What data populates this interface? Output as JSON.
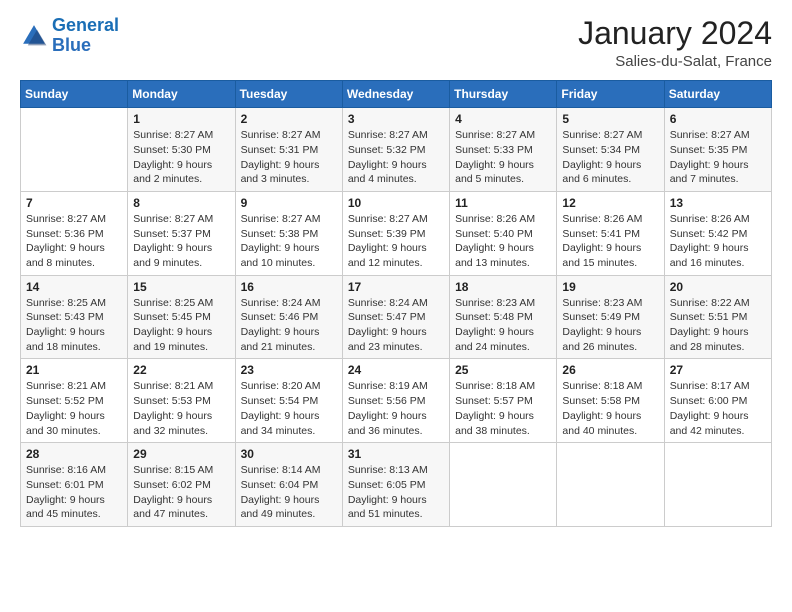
{
  "logo": {
    "line1": "General",
    "line2": "Blue"
  },
  "header": {
    "month_year": "January 2024",
    "location": "Salies-du-Salat, France"
  },
  "weekdays": [
    "Sunday",
    "Monday",
    "Tuesday",
    "Wednesday",
    "Thursday",
    "Friday",
    "Saturday"
  ],
  "weeks": [
    [
      {
        "day": "",
        "info": ""
      },
      {
        "day": "1",
        "info": "Sunrise: 8:27 AM\nSunset: 5:30 PM\nDaylight: 9 hours\nand 2 minutes."
      },
      {
        "day": "2",
        "info": "Sunrise: 8:27 AM\nSunset: 5:31 PM\nDaylight: 9 hours\nand 3 minutes."
      },
      {
        "day": "3",
        "info": "Sunrise: 8:27 AM\nSunset: 5:32 PM\nDaylight: 9 hours\nand 4 minutes."
      },
      {
        "day": "4",
        "info": "Sunrise: 8:27 AM\nSunset: 5:33 PM\nDaylight: 9 hours\nand 5 minutes."
      },
      {
        "day": "5",
        "info": "Sunrise: 8:27 AM\nSunset: 5:34 PM\nDaylight: 9 hours\nand 6 minutes."
      },
      {
        "day": "6",
        "info": "Sunrise: 8:27 AM\nSunset: 5:35 PM\nDaylight: 9 hours\nand 7 minutes."
      }
    ],
    [
      {
        "day": "7",
        "info": "Sunrise: 8:27 AM\nSunset: 5:36 PM\nDaylight: 9 hours\nand 8 minutes."
      },
      {
        "day": "8",
        "info": "Sunrise: 8:27 AM\nSunset: 5:37 PM\nDaylight: 9 hours\nand 9 minutes."
      },
      {
        "day": "9",
        "info": "Sunrise: 8:27 AM\nSunset: 5:38 PM\nDaylight: 9 hours\nand 10 minutes."
      },
      {
        "day": "10",
        "info": "Sunrise: 8:27 AM\nSunset: 5:39 PM\nDaylight: 9 hours\nand 12 minutes."
      },
      {
        "day": "11",
        "info": "Sunrise: 8:26 AM\nSunset: 5:40 PM\nDaylight: 9 hours\nand 13 minutes."
      },
      {
        "day": "12",
        "info": "Sunrise: 8:26 AM\nSunset: 5:41 PM\nDaylight: 9 hours\nand 15 minutes."
      },
      {
        "day": "13",
        "info": "Sunrise: 8:26 AM\nSunset: 5:42 PM\nDaylight: 9 hours\nand 16 minutes."
      }
    ],
    [
      {
        "day": "14",
        "info": "Sunrise: 8:25 AM\nSunset: 5:43 PM\nDaylight: 9 hours\nand 18 minutes."
      },
      {
        "day": "15",
        "info": "Sunrise: 8:25 AM\nSunset: 5:45 PM\nDaylight: 9 hours\nand 19 minutes."
      },
      {
        "day": "16",
        "info": "Sunrise: 8:24 AM\nSunset: 5:46 PM\nDaylight: 9 hours\nand 21 minutes."
      },
      {
        "day": "17",
        "info": "Sunrise: 8:24 AM\nSunset: 5:47 PM\nDaylight: 9 hours\nand 23 minutes."
      },
      {
        "day": "18",
        "info": "Sunrise: 8:23 AM\nSunset: 5:48 PM\nDaylight: 9 hours\nand 24 minutes."
      },
      {
        "day": "19",
        "info": "Sunrise: 8:23 AM\nSunset: 5:49 PM\nDaylight: 9 hours\nand 26 minutes."
      },
      {
        "day": "20",
        "info": "Sunrise: 8:22 AM\nSunset: 5:51 PM\nDaylight: 9 hours\nand 28 minutes."
      }
    ],
    [
      {
        "day": "21",
        "info": "Sunrise: 8:21 AM\nSunset: 5:52 PM\nDaylight: 9 hours\nand 30 minutes."
      },
      {
        "day": "22",
        "info": "Sunrise: 8:21 AM\nSunset: 5:53 PM\nDaylight: 9 hours\nand 32 minutes."
      },
      {
        "day": "23",
        "info": "Sunrise: 8:20 AM\nSunset: 5:54 PM\nDaylight: 9 hours\nand 34 minutes."
      },
      {
        "day": "24",
        "info": "Sunrise: 8:19 AM\nSunset: 5:56 PM\nDaylight: 9 hours\nand 36 minutes."
      },
      {
        "day": "25",
        "info": "Sunrise: 8:18 AM\nSunset: 5:57 PM\nDaylight: 9 hours\nand 38 minutes."
      },
      {
        "day": "26",
        "info": "Sunrise: 8:18 AM\nSunset: 5:58 PM\nDaylight: 9 hours\nand 40 minutes."
      },
      {
        "day": "27",
        "info": "Sunrise: 8:17 AM\nSunset: 6:00 PM\nDaylight: 9 hours\nand 42 minutes."
      }
    ],
    [
      {
        "day": "28",
        "info": "Sunrise: 8:16 AM\nSunset: 6:01 PM\nDaylight: 9 hours\nand 45 minutes."
      },
      {
        "day": "29",
        "info": "Sunrise: 8:15 AM\nSunset: 6:02 PM\nDaylight: 9 hours\nand 47 minutes."
      },
      {
        "day": "30",
        "info": "Sunrise: 8:14 AM\nSunset: 6:04 PM\nDaylight: 9 hours\nand 49 minutes."
      },
      {
        "day": "31",
        "info": "Sunrise: 8:13 AM\nSunset: 6:05 PM\nDaylight: 9 hours\nand 51 minutes."
      },
      {
        "day": "",
        "info": ""
      },
      {
        "day": "",
        "info": ""
      },
      {
        "day": "",
        "info": ""
      }
    ]
  ]
}
